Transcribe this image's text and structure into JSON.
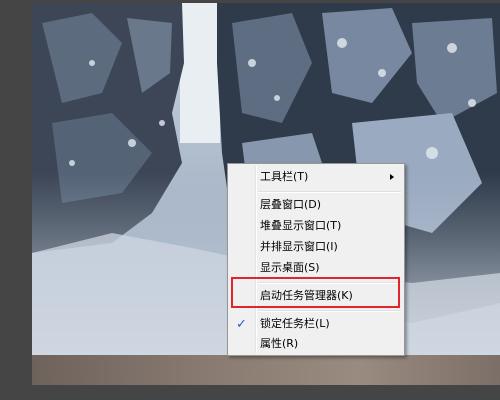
{
  "context_menu": {
    "items": [
      {
        "label": "工具栏(T)",
        "submenu": true
      },
      {
        "label": "层叠窗口(D)"
      },
      {
        "label": "堆叠显示窗口(T)"
      },
      {
        "label": "并排显示窗口(I)"
      },
      {
        "label": "显示桌面(S)"
      },
      {
        "label": "启动任务管理器(K)",
        "highlighted": true
      },
      {
        "label": "锁定任务栏(L)",
        "checked": true,
        "check_mark": "✓"
      },
      {
        "label": "属性(R)"
      }
    ]
  },
  "colors": {
    "highlight_box": "#e0262a",
    "check_mark": "#1e5fd2",
    "menu_background": "#f0f0f0"
  }
}
